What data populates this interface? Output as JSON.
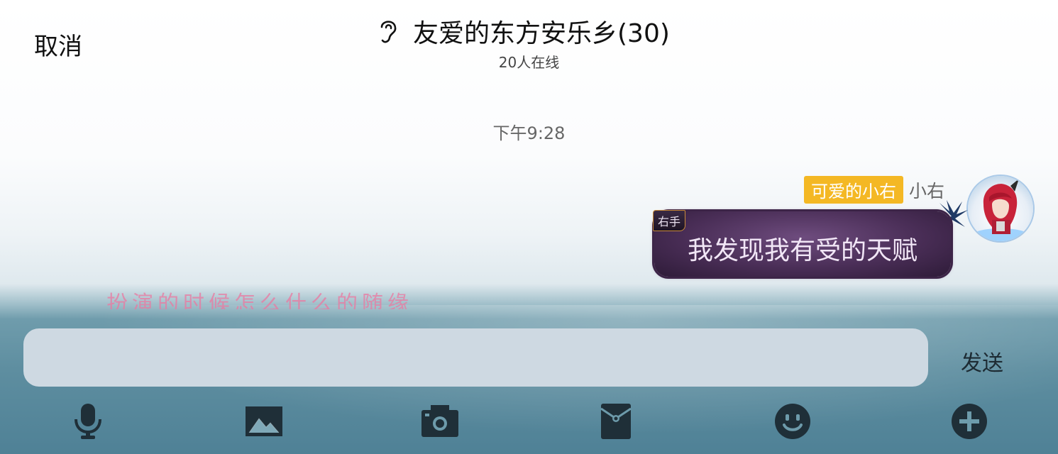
{
  "header": {
    "cancel_label": "取消",
    "title": "友爱的东方安乐乡(30)",
    "online_status": "20人在线"
  },
  "chat": {
    "timestamp": "下午9:28",
    "messages": [
      {
        "sender_title_badge": "可爱的小右",
        "sender_name": "小右",
        "bubble_tag": "右手",
        "text": "我发现我有受的天赋"
      }
    ]
  },
  "background_overlay_text": "扮演的时候怎么什么的随缘",
  "composer": {
    "input_value": "",
    "input_placeholder": "",
    "send_label": "发送"
  },
  "toolbar": {
    "icons": [
      "microphone-icon",
      "image-icon",
      "camera-icon",
      "red-packet-icon",
      "emoji-icon",
      "add-icon"
    ]
  },
  "colors": {
    "title_badge": "#f4b824",
    "bubble": "#4a2e57",
    "input_bg": "#ced9e2",
    "toolbar_icon": "#1f2f38"
  }
}
